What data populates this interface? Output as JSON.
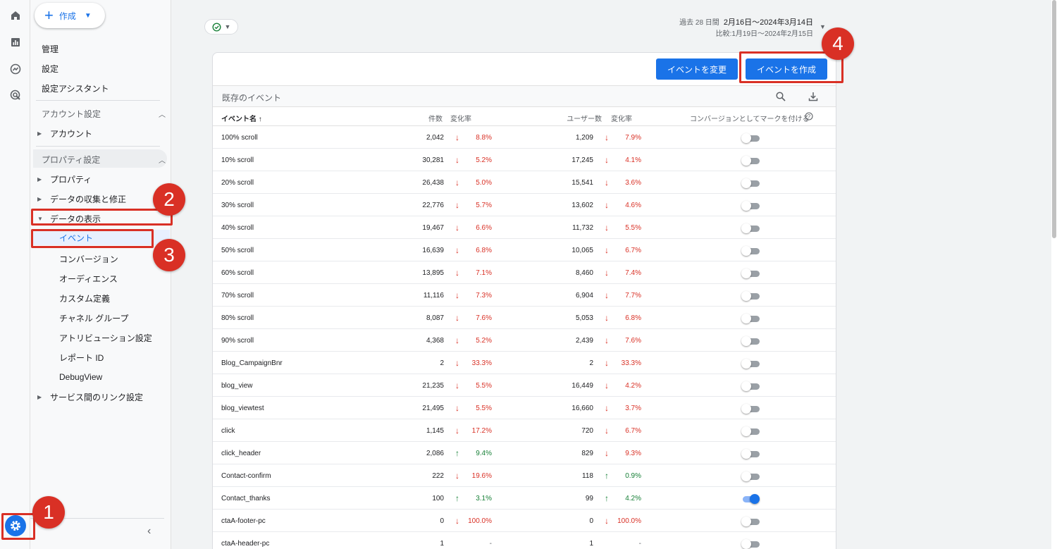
{
  "header": {
    "create_label": "作成",
    "date_label": "過去 28 日間",
    "date_range": "2月16日～2024年3月14日",
    "compare_range": "比較:1月19日～2024年2月15日"
  },
  "sidebar": {
    "admin": "管理",
    "settings": "設定",
    "setup_assistant": "設定アシスタント",
    "account_settings": "アカウント設定",
    "account": "アカウント",
    "property_settings": "プロパティ設定",
    "property": "プロパティ",
    "data_collection": "データの収集と修正",
    "data_display": "データの表示",
    "sub_items": [
      "イベント",
      "コンバージョン",
      "オーディエンス",
      "カスタム定義",
      "チャネル グループ",
      "アトリビューション設定",
      "レポート ID",
      "DebugView"
    ],
    "service_links": "サービス間のリンク設定"
  },
  "card": {
    "modify_button": "イベントを変更",
    "create_button": "イベントを作成",
    "title": "既存のイベント",
    "columns": {
      "name": "イベント名 ↑",
      "count": "件数",
      "count_change": "変化率",
      "users": "ユーザー数",
      "users_change": "変化率",
      "conversion": "コンバージョンとしてマークを付ける"
    }
  },
  "annotations": [
    "1",
    "2",
    "3",
    "4"
  ],
  "rows": [
    {
      "name": "100% scroll",
      "count": "2,042",
      "cdir": "down",
      "cpct": "8.8%",
      "users": "1,209",
      "udir": "down",
      "upct": "7.9%",
      "conv": false
    },
    {
      "name": "10% scroll",
      "count": "30,281",
      "cdir": "down",
      "cpct": "5.2%",
      "users": "17,245",
      "udir": "down",
      "upct": "4.1%",
      "conv": false
    },
    {
      "name": "20% scroll",
      "count": "26,438",
      "cdir": "down",
      "cpct": "5.0%",
      "users": "15,541",
      "udir": "down",
      "upct": "3.6%",
      "conv": false
    },
    {
      "name": "30% scroll",
      "count": "22,776",
      "cdir": "down",
      "cpct": "5.7%",
      "users": "13,602",
      "udir": "down",
      "upct": "4.6%",
      "conv": false
    },
    {
      "name": "40% scroll",
      "count": "19,467",
      "cdir": "down",
      "cpct": "6.6%",
      "users": "11,732",
      "udir": "down",
      "upct": "5.5%",
      "conv": false
    },
    {
      "name": "50% scroll",
      "count": "16,639",
      "cdir": "down",
      "cpct": "6.8%",
      "users": "10,065",
      "udir": "down",
      "upct": "6.7%",
      "conv": false
    },
    {
      "name": "60% scroll",
      "count": "13,895",
      "cdir": "down",
      "cpct": "7.1%",
      "users": "8,460",
      "udir": "down",
      "upct": "7.4%",
      "conv": false
    },
    {
      "name": "70% scroll",
      "count": "11,116",
      "cdir": "down",
      "cpct": "7.3%",
      "users": "6,904",
      "udir": "down",
      "upct": "7.7%",
      "conv": false
    },
    {
      "name": "80% scroll",
      "count": "8,087",
      "cdir": "down",
      "cpct": "7.6%",
      "users": "5,053",
      "udir": "down",
      "upct": "6.8%",
      "conv": false
    },
    {
      "name": "90% scroll",
      "count": "4,368",
      "cdir": "down",
      "cpct": "5.2%",
      "users": "2,439",
      "udir": "down",
      "upct": "7.6%",
      "conv": false
    },
    {
      "name": "Blog_CampaignBnr",
      "count": "2",
      "cdir": "down",
      "cpct": "33.3%",
      "users": "2",
      "udir": "down",
      "upct": "33.3%",
      "conv": false
    },
    {
      "name": "blog_view",
      "count": "21,235",
      "cdir": "down",
      "cpct": "5.5%",
      "users": "16,449",
      "udir": "down",
      "upct": "4.2%",
      "conv": false
    },
    {
      "name": "blog_viewtest",
      "count": "21,495",
      "cdir": "down",
      "cpct": "5.5%",
      "users": "16,660",
      "udir": "down",
      "upct": "3.7%",
      "conv": false
    },
    {
      "name": "click",
      "count": "1,145",
      "cdir": "down",
      "cpct": "17.2%",
      "users": "720",
      "udir": "down",
      "upct": "6.7%",
      "conv": false
    },
    {
      "name": "click_header",
      "count": "2,086",
      "cdir": "up",
      "cpct": "9.4%",
      "users": "829",
      "udir": "down",
      "upct": "9.3%",
      "conv": false
    },
    {
      "name": "Contact-confirm",
      "count": "222",
      "cdir": "down",
      "cpct": "19.6%",
      "users": "118",
      "udir": "up",
      "upct": "0.9%",
      "conv": false
    },
    {
      "name": "Contact_thanks",
      "count": "100",
      "cdir": "up",
      "cpct": "3.1%",
      "users": "99",
      "udir": "up",
      "upct": "4.2%",
      "conv": true
    },
    {
      "name": "ctaA-footer-pc",
      "count": "0",
      "cdir": "down",
      "cpct": "100.0%",
      "users": "0",
      "udir": "down",
      "upct": "100.0%",
      "conv": false
    },
    {
      "name": "ctaA-header-pc",
      "count": "1",
      "cdir": "none",
      "cpct": "-",
      "users": "1",
      "udir": "none",
      "upct": "-",
      "conv": false
    }
  ]
}
